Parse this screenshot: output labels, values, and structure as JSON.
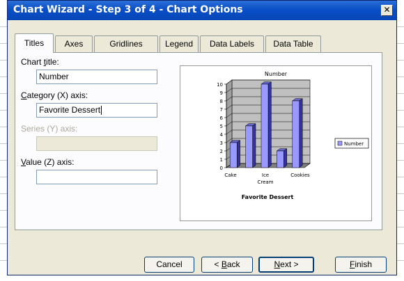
{
  "window": {
    "title": "Chart Wizard - Step 3 of 4 - Chart Options",
    "close_label": "✕"
  },
  "tabs": [
    {
      "label": "Titles",
      "active": true
    },
    {
      "label": "Axes",
      "active": false
    },
    {
      "label": "Gridlines",
      "active": false
    },
    {
      "label": "Legend",
      "active": false
    },
    {
      "label": "Data Labels",
      "active": false
    },
    {
      "label": "Data Table",
      "active": false
    }
  ],
  "form": {
    "chart_title": {
      "label_pre": "Chart ",
      "label_u": "t",
      "label_post": "itle:",
      "value": "Number"
    },
    "category_axis": {
      "label_pre": "",
      "label_u": "C",
      "label_post": "ategory (X) axis:",
      "value": "Favorite Dessert"
    },
    "series_axis": {
      "label": "Series (Y) axis:",
      "value": "",
      "disabled": true
    },
    "value_axis": {
      "label_pre": "",
      "label_u": "V",
      "label_post": "alue (Z) axis:",
      "value": ""
    }
  },
  "chart_data": {
    "type": "bar",
    "title": "Number",
    "xlabel": "Favorite Dessert",
    "ylabel": "",
    "categories": [
      "Cake",
      "Ice Cream",
      "Cookies"
    ],
    "category_lines": [
      [
        "Cake"
      ],
      [
        "Ice",
        "Cream"
      ],
      [
        "Cookies"
      ]
    ],
    "series": [
      {
        "name": "Number",
        "values": [
          3,
          5,
          10,
          2,
          8
        ]
      }
    ],
    "y_ticks": [
      0,
      1,
      2,
      3,
      4,
      5,
      6,
      7,
      8,
      9,
      10
    ],
    "ylim": [
      0,
      10
    ],
    "grid": true,
    "legend": "right",
    "colors": {
      "bar_front": "#9999ff",
      "bar_side": "#333399",
      "bar_top": "#6666cc",
      "wall": "#c0c0c0",
      "floor": "#808080"
    }
  },
  "buttons": {
    "cancel": "Cancel",
    "back_pre": "< ",
    "back_u": "B",
    "back_post": "ack",
    "next_u": "N",
    "next_post": "ext >",
    "finish_u": "F",
    "finish_post": "inish"
  }
}
